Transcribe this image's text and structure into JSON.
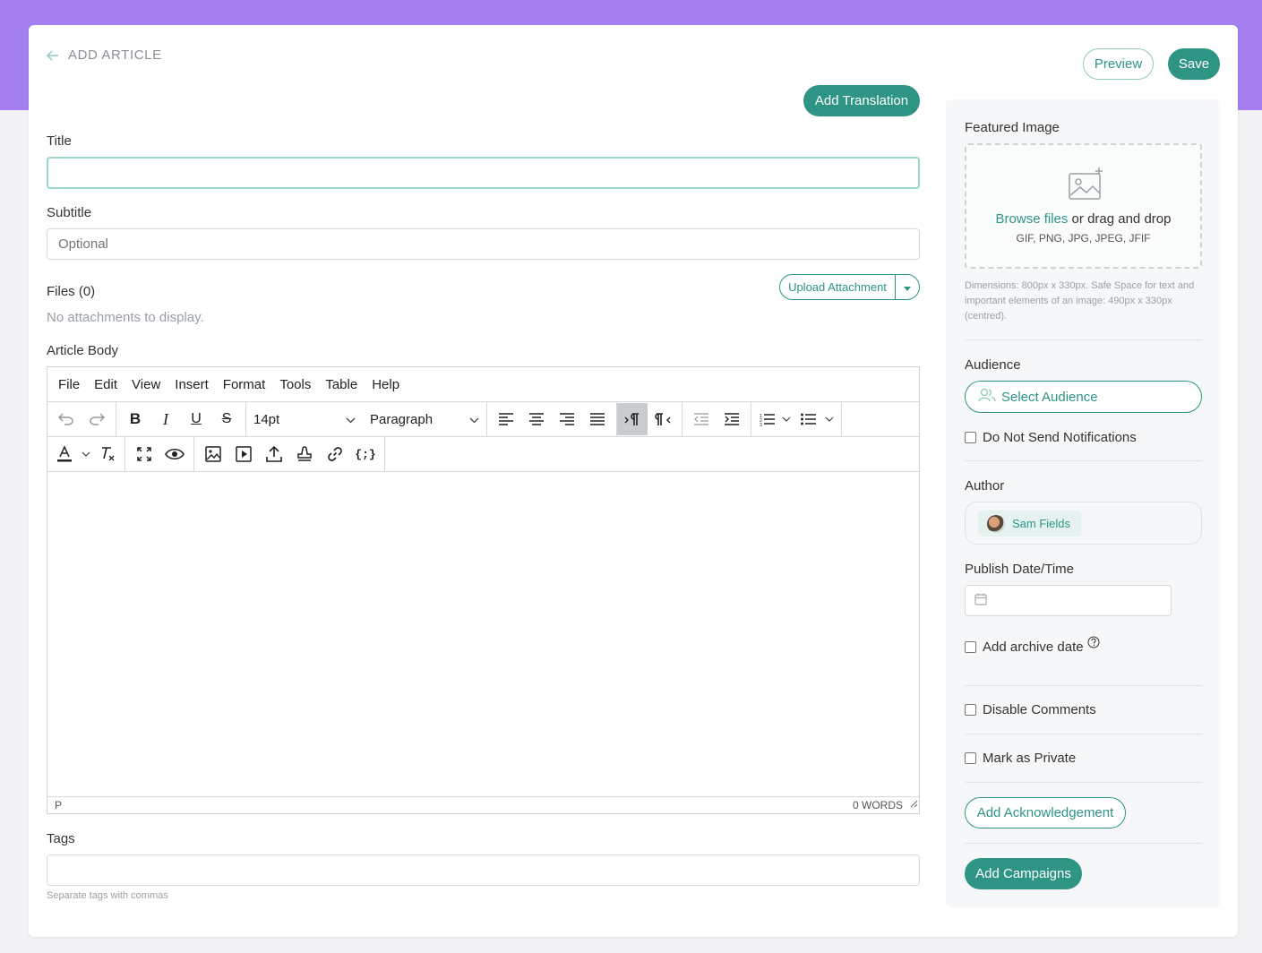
{
  "header": {
    "back_label": "ADD ARTICLE",
    "preview_label": "Preview",
    "save_label": "Save"
  },
  "main": {
    "add_translation_label": "Add Translation",
    "title_label": "Title",
    "title_value": "",
    "subtitle_label": "Subtitle",
    "subtitle_placeholder": "Optional",
    "files_label": "Files (0)",
    "upload_label": "Upload Attachment",
    "no_attachments": "No attachments to display.",
    "body_label": "Article Body",
    "tags_label": "Tags",
    "tags_hint": "Separate tags with commas"
  },
  "editor": {
    "menu": [
      "File",
      "Edit",
      "View",
      "Insert",
      "Format",
      "Tools",
      "Table",
      "Help"
    ],
    "font_size": "14pt",
    "block_format": "Paragraph",
    "status_path": "P",
    "word_count": "0 WORDS"
  },
  "sidebar": {
    "featured_image_label": "Featured Image",
    "browse_link": "Browse files",
    "drag_text": " or drag and drop",
    "formats": "GIF, PNG, JPG, JPEG, JFIF",
    "dimensions_note": "Dimensions: 800px x 330px. Safe Space for text and important elements of an image: 490px x 330px (centred).",
    "audience_label": "Audience",
    "select_audience": "Select Audience",
    "do_not_notify": "Do Not Send Notifications",
    "author_label": "Author",
    "author_name": "Sam Fields",
    "publish_label": "Publish Date/Time",
    "archive_label": "Add archive date",
    "disable_comments": "Disable Comments",
    "mark_private": "Mark as Private",
    "add_ack": "Add Acknowledgement",
    "add_campaigns": "Add Campaigns"
  },
  "colors": {
    "accent": "#2e9585",
    "header_band": "#a37ff0"
  }
}
